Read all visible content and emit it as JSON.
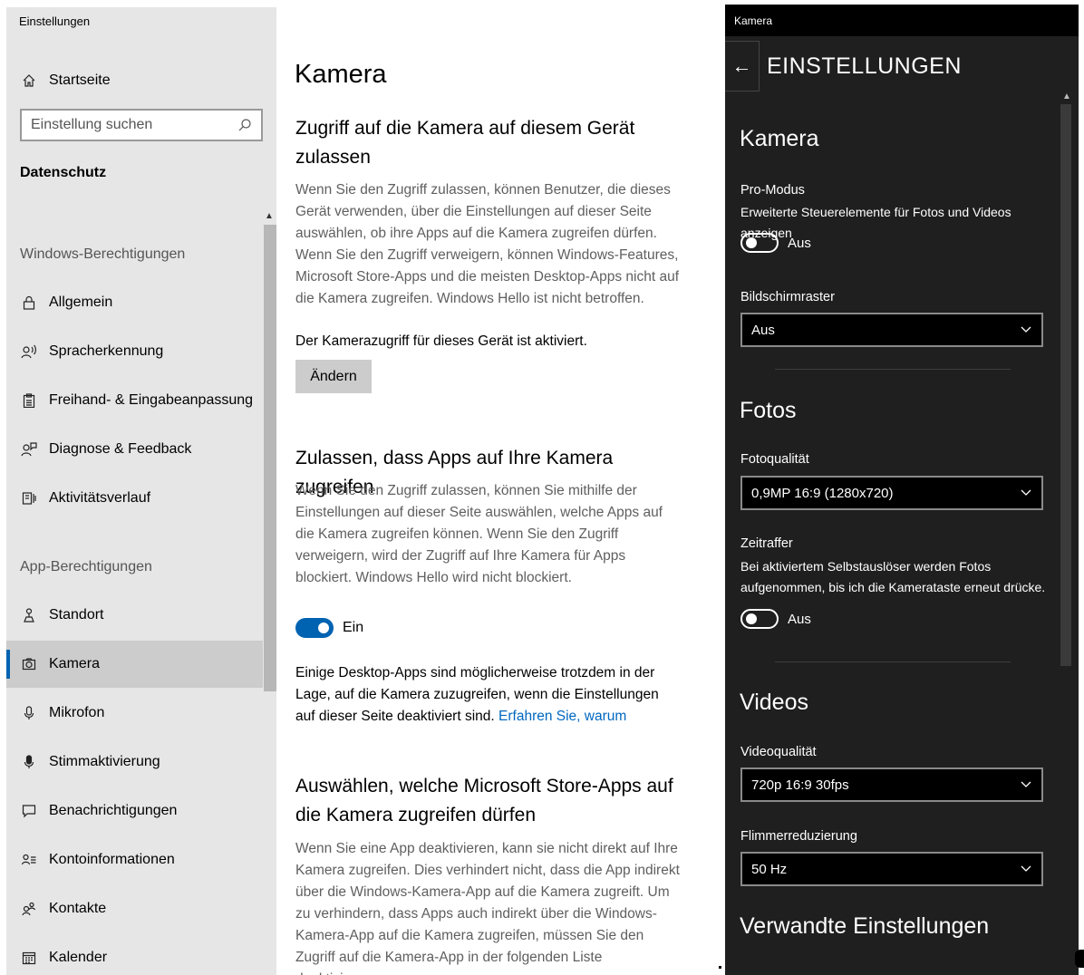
{
  "settings": {
    "window_title": "Einstellungen",
    "home_label": "Startseite",
    "search_placeholder": "Einstellung suchen",
    "section": "Datenschutz",
    "group_windows": "Windows-Berechtigungen",
    "windows_items": [
      {
        "label": "Allgemein",
        "icon": "lock-icon"
      },
      {
        "label": "Spracherkennung",
        "icon": "speech-icon"
      },
      {
        "label": "Freihand- & Eingabeanpassung",
        "icon": "clipboard-icon"
      },
      {
        "label": "Diagnose & Feedback",
        "icon": "feedback-icon"
      },
      {
        "label": "Aktivitätsverlauf",
        "icon": "history-icon"
      }
    ],
    "group_apps": "App-Berechtigungen",
    "app_items": [
      {
        "label": "Standort",
        "icon": "location-icon"
      },
      {
        "label": "Kamera",
        "icon": "camera-icon",
        "selected": true
      },
      {
        "label": "Mikrofon",
        "icon": "microphone-icon"
      },
      {
        "label": "Stimmaktivierung",
        "icon": "voice-icon"
      },
      {
        "label": "Benachrichtigungen",
        "icon": "notification-icon"
      },
      {
        "label": "Kontoinformationen",
        "icon": "account-icon"
      },
      {
        "label": "Kontakte",
        "icon": "contacts-icon"
      },
      {
        "label": "Kalender",
        "icon": "calendar-icon"
      }
    ]
  },
  "content": {
    "title": "Kamera",
    "device_heading": "Zugriff auf die Kamera auf diesem Gerät zulassen",
    "device_desc": "Wenn Sie den Zugriff zulassen, können Benutzer, die dieses Gerät verwenden, über die Einstellungen auf dieser Seite auswählen, ob ihre Apps auf die Kamera zugreifen dürfen. Wenn Sie den Zugriff verweigern, können Windows-Features, Microsoft Store-Apps und die meisten Desktop-Apps nicht auf die Kamera zugreifen. Windows Hello ist nicht betroffen.",
    "device_status": "Der Kamerazugriff für dieses Gerät ist aktiviert.",
    "change_button": "Ändern",
    "apps_heading": "Zulassen, dass Apps auf Ihre Kamera zugreifen",
    "apps_desc": "Wenn Sie den Zugriff zulassen, können Sie mithilfe der Einstellungen auf dieser Seite auswählen, welche Apps auf die Kamera zugreifen können. Wenn Sie den Zugriff verweigern, wird der Zugriff auf Ihre Kamera für Apps blockiert. Windows Hello wird nicht blockiert.",
    "apps_toggle_label": "Ein",
    "desktop_note": "Einige Desktop-Apps sind möglicherweise trotzdem in der Lage, auf die Kamera zuzugreifen, wenn die Einstellungen auf dieser Seite deaktiviert sind.",
    "learn_more_link": "Erfahren Sie, warum",
    "store_heading": "Auswählen, welche Microsoft Store-Apps auf die Kamera zugreifen dürfen",
    "store_desc": "Wenn Sie eine App deaktivieren, kann sie nicht direkt auf Ihre Kamera zugreifen. Dies verhindert nicht, dass die App indirekt über die Windows-Kamera-App auf die Kamera zugreift. Um zu verhindern, dass Apps auch indirekt über die Windows-Kamera-App auf die Kamera zugreifen, müssen Sie den Zugriff auf die Kamera-App in der folgenden Liste deaktivieren."
  },
  "camera_app": {
    "window_title": "Kamera",
    "header": "EINSTELLUNGEN",
    "section_camera": "Kamera",
    "pro_mode_label": "Pro-Modus",
    "pro_mode_desc": "Erweiterte Steuerelemente für Fotos und Videos anzeigen",
    "pro_mode_toggle": "Aus",
    "grid_label": "Bildschirmraster",
    "grid_value": "Aus",
    "section_photos": "Fotos",
    "photo_quality_label": "Fotoqualität",
    "photo_quality_value": "0,9MP 16:9 (1280x720)",
    "timelapse_label": "Zeitraffer",
    "timelapse_desc": "Bei aktiviertem Selbstauslöser werden Fotos aufgenommen, bis ich die Kamerataste erneut drücke.",
    "timelapse_toggle": "Aus",
    "section_videos": "Videos",
    "video_quality_label": "Videoqualität",
    "video_quality_value": "720p 16:9 30fps",
    "flicker_label": "Flimmerreduzierung",
    "flicker_value": "50 Hz",
    "section_related": "Verwandte Einstellungen"
  }
}
